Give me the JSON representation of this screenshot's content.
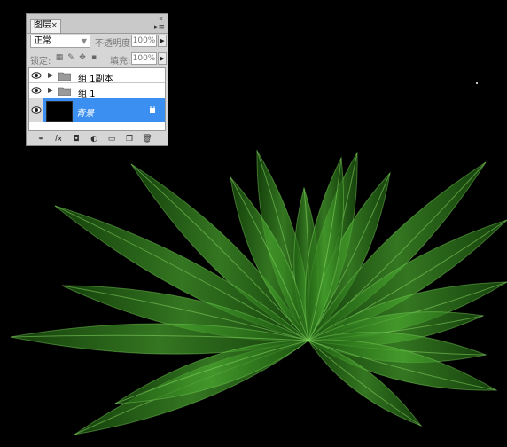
{
  "panel": {
    "tab_title": "图层",
    "close_glyph": "×",
    "collapse_glyph": "«",
    "menu_glyph": "▸≡",
    "blend_mode": "正常",
    "opacity_label": "不透明度:",
    "opacity_value": "100%",
    "lock_label": "锁定:",
    "fill_label": "填充:",
    "fill_value": "100%"
  },
  "layers": [
    {
      "name": "组 1副本",
      "type": "group",
      "visible": true,
      "selected": false
    },
    {
      "name": "组 1",
      "type": "group",
      "visible": true,
      "selected": false
    },
    {
      "name": "背景",
      "type": "background",
      "visible": true,
      "selected": true
    }
  ],
  "bottom_icons": [
    "link-icon",
    "fx-icon",
    "mask-icon",
    "adjustment-icon",
    "new-group-icon",
    "new-layer-icon",
    "trash-icon"
  ],
  "colors": {
    "canvas": "#000000",
    "selection": "#3a8ff0",
    "plant": "#3f9a28"
  }
}
